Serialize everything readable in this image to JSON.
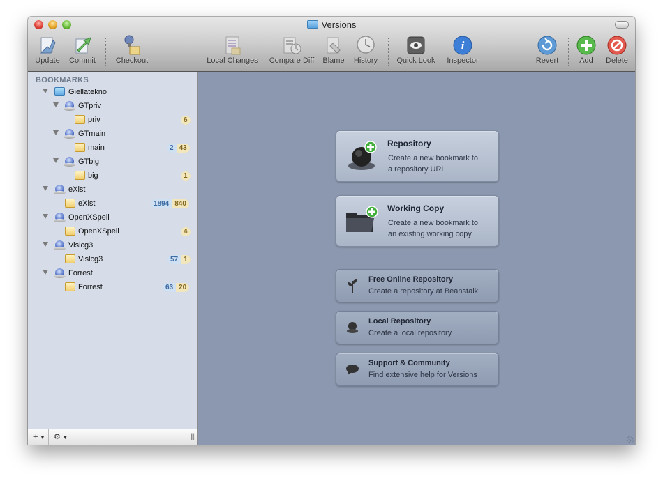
{
  "window": {
    "title": "Versions"
  },
  "toolbar": {
    "items": [
      {
        "label": "Update",
        "icon": "update-icon"
      },
      {
        "label": "Commit",
        "icon": "commit-icon"
      },
      {
        "label": "Checkout",
        "icon": "checkout-icon"
      },
      {
        "label": "Local Changes",
        "icon": "local-changes-icon"
      },
      {
        "label": "Compare Diff",
        "icon": "compare-diff-icon"
      },
      {
        "label": "Blame",
        "icon": "blame-icon"
      },
      {
        "label": "History",
        "icon": "history-icon"
      },
      {
        "label": "Quick Look",
        "icon": "quick-look-icon"
      },
      {
        "label": "Inspector",
        "icon": "inspector-icon"
      },
      {
        "label": "Revert",
        "icon": "revert-icon"
      },
      {
        "label": "Add",
        "icon": "add-icon"
      },
      {
        "label": "Delete",
        "icon": "delete-icon"
      }
    ]
  },
  "sidebar": {
    "header": "BOOKMARKS",
    "tree": [
      {
        "label": "Giellatekno",
        "type": "group"
      },
      {
        "label": "GTpriv",
        "type": "repo"
      },
      {
        "label": "priv",
        "type": "folder",
        "badge_yellow": "6"
      },
      {
        "label": "GTmain",
        "type": "repo"
      },
      {
        "label": "main",
        "type": "folder",
        "badge_blue": "2",
        "badge_yellow": "43"
      },
      {
        "label": "GTbig",
        "type": "repo"
      },
      {
        "label": "big",
        "type": "folder",
        "badge_yellow": "1"
      },
      {
        "label": "eXist",
        "type": "repo"
      },
      {
        "label": "eXist",
        "type": "folder",
        "badge_blue": "1894",
        "badge_yellow": "840"
      },
      {
        "label": "OpenXSpell",
        "type": "repo"
      },
      {
        "label": "OpenXSpell",
        "type": "folder",
        "badge_yellow": "4"
      },
      {
        "label": "Vislcg3",
        "type": "repo"
      },
      {
        "label": "Vislcg3",
        "type": "folder",
        "badge_blue": "57",
        "badge_yellow": "1"
      },
      {
        "label": "Forrest",
        "type": "repo"
      },
      {
        "label": "Forrest",
        "type": "folder",
        "badge_blue": "63",
        "badge_yellow": "20"
      }
    ],
    "bottom": {
      "add_label": "+",
      "gear_label": "⚙",
      "grip": "|||"
    }
  },
  "main": {
    "repository": {
      "title": "Repository",
      "desc_1": "Create a new bookmark to",
      "desc_2": "a repository URL"
    },
    "working_copy": {
      "title": "Working Copy",
      "desc_1": "Create a new bookmark to",
      "desc_2": "an existing working copy"
    },
    "free_online": {
      "title": "Free Online Repository",
      "desc": "Create a repository at Beanstalk"
    },
    "local_repo": {
      "title": "Local Repository",
      "desc": "Create a local repository"
    },
    "support": {
      "title": "Support & Community",
      "desc": "Find extensive help for Versions"
    }
  }
}
